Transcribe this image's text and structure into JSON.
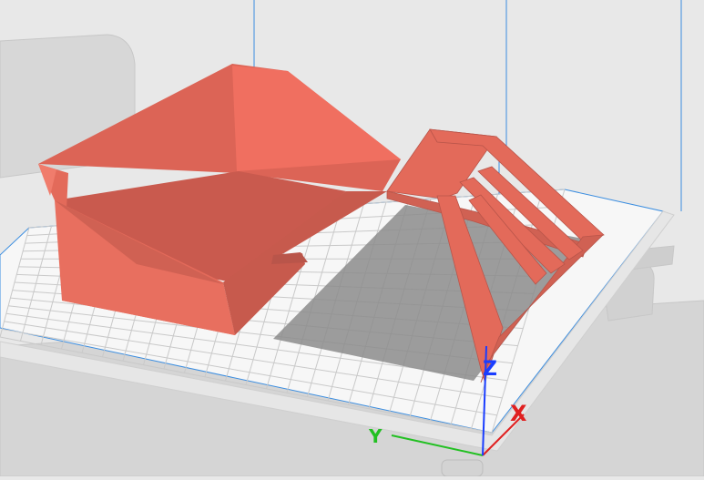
{
  "viewport": {
    "type": "3d-print-preview",
    "colors": {
      "background": "#e8e8e8",
      "bed": "#f5f5f5",
      "grid": "#c8c8c8",
      "bed_border": "#3a8de0",
      "model": "#e36a5a",
      "model_dark": "#b9554a",
      "model_light": "#f07c6c",
      "shadow": "#8a8a8a",
      "printer_frame": "#dcdcdc",
      "x_axis": "#e02020",
      "y_axis": "#22c022",
      "z_axis": "#1a3dff"
    }
  },
  "axes": {
    "x_label": "X",
    "y_label": "Y",
    "z_label": "Z"
  }
}
